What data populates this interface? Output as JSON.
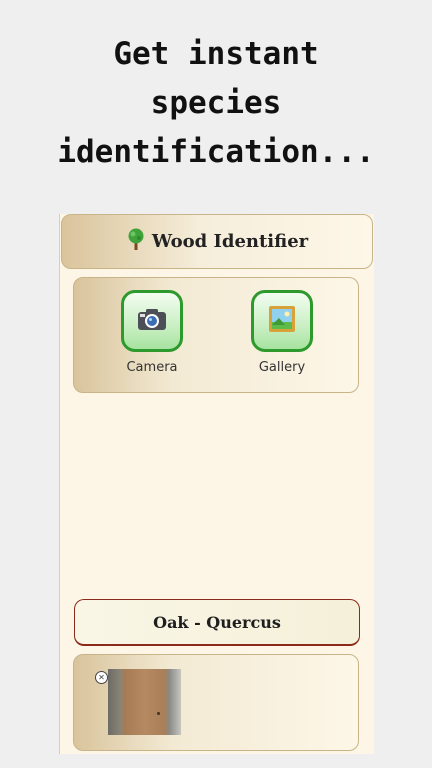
{
  "headline": {
    "line1": "Get instant",
    "line2": "species",
    "line3": "identification..."
  },
  "app": {
    "title_icon": "tree-icon",
    "title": "Wood Identifier",
    "camera_icon": "camera-icon",
    "camera_label": "Camera",
    "gallery_icon": "picture-icon",
    "gallery_label": "Gallery",
    "result_label": "Oak - Quercus",
    "ad_close_icon": "close-icon"
  },
  "colors": {
    "button_border": "#2e9a2e",
    "background": "#fdf6e6",
    "result_border": "#8b2a1a"
  }
}
